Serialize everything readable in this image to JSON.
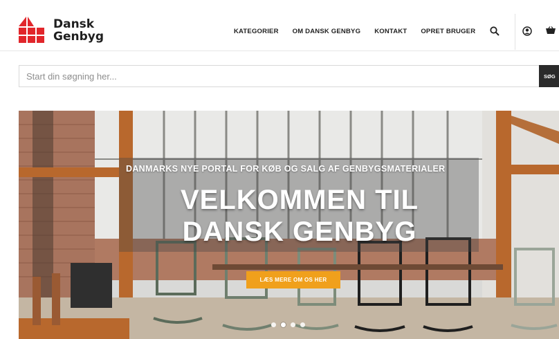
{
  "brand": {
    "name_line1": "Dansk",
    "name_line2": "Genbyg",
    "logo_color": "#e1262b"
  },
  "nav": {
    "items": [
      "KATEGORIER",
      "OM DANSK GENBYG",
      "KONTAKT",
      "OPRET BRUGER"
    ],
    "icons": [
      "search-icon",
      "user-icon",
      "cart-icon"
    ]
  },
  "search": {
    "placeholder": "Start din søgning her...",
    "value": "",
    "button_label": "SØG"
  },
  "hero": {
    "kicker": "DANMARKS NYE PORTAL FOR KØB OG SALG AF GENBYGSMATERIALER",
    "title_line1": "VELKOMMEN TIL",
    "title_line2": "DANSK GENBYG",
    "cta_label": "LÆS MERE OM OS HER",
    "cta_color": "#f0a01c",
    "slides": 4,
    "active_slide": 1
  }
}
